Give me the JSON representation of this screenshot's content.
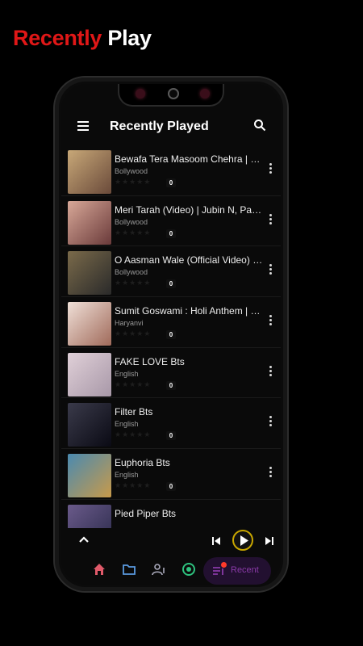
{
  "promo": {
    "word1": "Recently",
    "word2": "Play"
  },
  "appbar": {
    "title": "Recently Played"
  },
  "songs": [
    {
      "title": "Bewafa Tera Masoom Chehra | Rochak Kohli",
      "category": "Bollywood",
      "count": "0"
    },
    {
      "title": "Meri Tarah (Video) | Jubin N, Payal Dev",
      "category": "Bollywood",
      "count": "0"
    },
    {
      "title": "O Aasman Wale (Official Video) Ft. Jubin",
      "category": "Bollywood",
      "count": "0"
    },
    {
      "title": "Sumit Goswami : Holi Anthem | Khatarnak",
      "category": "Haryanvi",
      "count": "0"
    },
    {
      "title": "FAKE LOVE Bts",
      "category": "English",
      "count": "0"
    },
    {
      "title": "Filter Bts",
      "category": "English",
      "count": "0"
    },
    {
      "title": "Euphoria Bts",
      "category": "English",
      "count": "0"
    },
    {
      "title": "Pied Piper Bts",
      "category": "",
      "count": ""
    }
  ],
  "thumb_colors": [
    "#8a6a4a",
    "#b07a6a",
    "#5a4a3a",
    "#d8b8a8",
    "#c8b8c8",
    "#2a2a3a",
    "#3a6a8a",
    "#4a3a6a"
  ],
  "nav": {
    "recent_label": "Recent"
  },
  "colors": {
    "accent": "#c8a600",
    "promo_red": "#e01717",
    "recent_pill": "#221030",
    "recent_text": "#8a3aa8"
  },
  "icons": [
    "menu-icon",
    "search-icon",
    "more-vert-icon",
    "chevron-up-icon",
    "skip-previous-icon",
    "play-icon",
    "skip-next-icon",
    "home-icon",
    "folder-icon",
    "person-music-icon",
    "radio-icon",
    "playlist-icon"
  ]
}
